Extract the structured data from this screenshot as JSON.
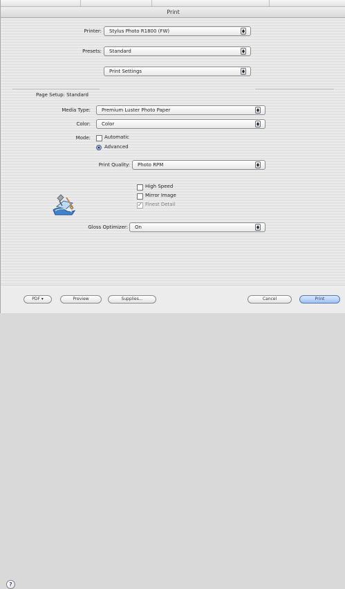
{
  "window": {
    "title": "Print"
  },
  "printer_section": {
    "printer_label": "Printer:",
    "printer_value": "Stylus Photo R1800 (FW)",
    "presets_label": "Presets:",
    "presets_value": "Standard",
    "pane_value": "Print Settings"
  },
  "settings": {
    "page_setup_label": "Page Setup:",
    "page_setup_value": "Standard",
    "media_type_label": "Media Type:",
    "media_type_value": "Premium Luster Photo Paper",
    "color_label": "Color:",
    "color_value": "Color",
    "mode_label": "Mode:",
    "mode_options": [
      {
        "label": "Automatic",
        "selected": false
      },
      {
        "label": "Advanced",
        "selected": true
      }
    ],
    "print_quality_label": "Print Quality:",
    "print_quality_value": "Photo RPM",
    "quality_options": [
      {
        "label": "High Speed",
        "checked": false,
        "disabled": false
      },
      {
        "label": "Mirror Image",
        "checked": false,
        "disabled": false
      },
      {
        "label": "Finest Detail",
        "checked": true,
        "disabled": true
      }
    ],
    "gloss_optimizer_label": "Gloss Optimizer:",
    "gloss_optimizer_value": "On"
  },
  "buttons": {
    "help": "?",
    "pdf": "PDF ▾",
    "preview": "Preview",
    "supplies": "Supplies...",
    "cancel": "Cancel",
    "print": "Print"
  },
  "icons": {
    "help": "help-icon",
    "popup_arrows": "popup-arrows-icon",
    "printer": "printer-settings-icon"
  },
  "colors": {
    "primary_button": "#9fc0f0",
    "radio_selected": "#8fb0e4"
  }
}
